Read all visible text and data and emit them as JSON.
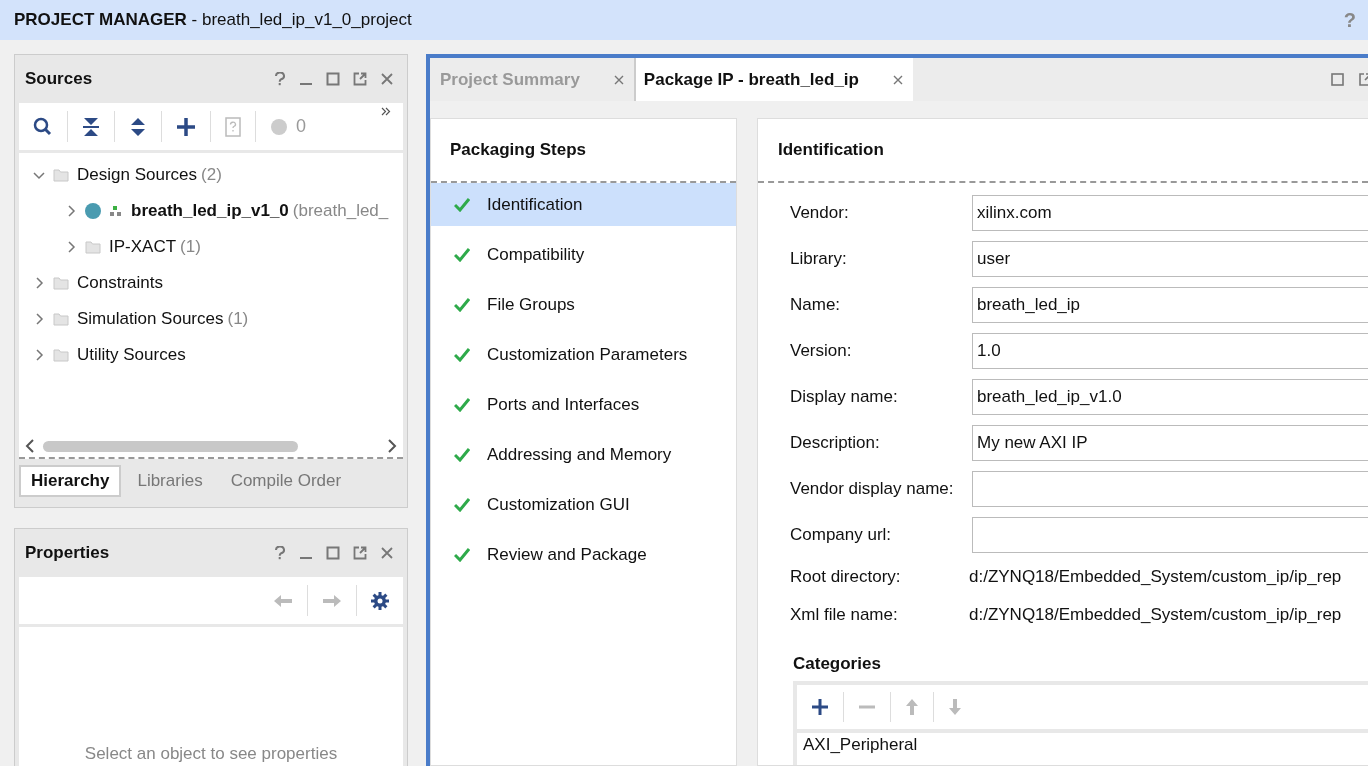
{
  "title_bar": {
    "title": "PROJECT MANAGER",
    "separator": "-",
    "project": "breath_led_ip_v1_0_project",
    "help": "?"
  },
  "sources": {
    "title": "Sources",
    "badge_count": "0",
    "tree": [
      {
        "label": "Design Sources",
        "count": "(2)",
        "kind": "folder",
        "expanded": true,
        "children": [
          {
            "label": "breath_led_ip_v1_0",
            "count": "(breath_led_",
            "kind": "module",
            "expanded": false
          },
          {
            "label": "IP-XACT",
            "count": "(1)",
            "kind": "folder",
            "expanded": false
          }
        ]
      },
      {
        "label": "Constraints",
        "kind": "folder",
        "expanded": false
      },
      {
        "label": "Simulation Sources",
        "count": "(1)",
        "kind": "folder",
        "expanded": false
      },
      {
        "label": "Utility Sources",
        "kind": "folder",
        "expanded": false
      }
    ],
    "tabs": [
      {
        "label": "Hierarchy",
        "selected": true
      },
      {
        "label": "Libraries",
        "selected": false
      },
      {
        "label": "Compile Order",
        "selected": false
      }
    ]
  },
  "properties": {
    "title": "Properties",
    "empty_message": "Select an object to see properties"
  },
  "editor_tabs": [
    {
      "label": "Project Summary",
      "selected": false
    },
    {
      "label": "Package IP - breath_led_ip",
      "selected": true
    }
  ],
  "packaging_steps": {
    "title": "Packaging Steps",
    "items": [
      {
        "label": "Identification",
        "checked": true,
        "selected": true
      },
      {
        "label": "Compatibility",
        "checked": true,
        "selected": false
      },
      {
        "label": "File Groups",
        "checked": true,
        "selected": false
      },
      {
        "label": "Customization Parameters",
        "checked": true,
        "selected": false
      },
      {
        "label": "Ports and Interfaces",
        "checked": true,
        "selected": false
      },
      {
        "label": "Addressing and Memory",
        "checked": true,
        "selected": false
      },
      {
        "label": "Customization GUI",
        "checked": true,
        "selected": false
      },
      {
        "label": "Review and Package",
        "checked": true,
        "selected": false
      }
    ]
  },
  "identification": {
    "title": "Identification",
    "fields": [
      {
        "label": "Vendor:",
        "value": "xilinx.com",
        "kind": "input"
      },
      {
        "label": "Library:",
        "value": "user",
        "kind": "input"
      },
      {
        "label": "Name:",
        "value": "breath_led_ip",
        "kind": "input"
      },
      {
        "label": "Version:",
        "value": "1.0",
        "kind": "input"
      },
      {
        "label": "Display name:",
        "value": "breath_led_ip_v1.0",
        "kind": "input"
      },
      {
        "label": "Description:",
        "value": "My new AXI IP",
        "kind": "input"
      },
      {
        "label": "Vendor display name:",
        "kind": "input"
      },
      {
        "label": "Company url:",
        "kind": "input"
      },
      {
        "label": "Root directory:",
        "value": "d:/ZYNQ18/Embedded_System/custom_ip/ip_rep",
        "kind": "text"
      },
      {
        "label": "Xml file name:",
        "value": "d:/ZYNQ18/Embedded_System/custom_ip/ip_rep",
        "kind": "text"
      }
    ],
    "categories": {
      "title": "Categories",
      "items": [
        "AXI_Peripheral"
      ]
    }
  }
}
